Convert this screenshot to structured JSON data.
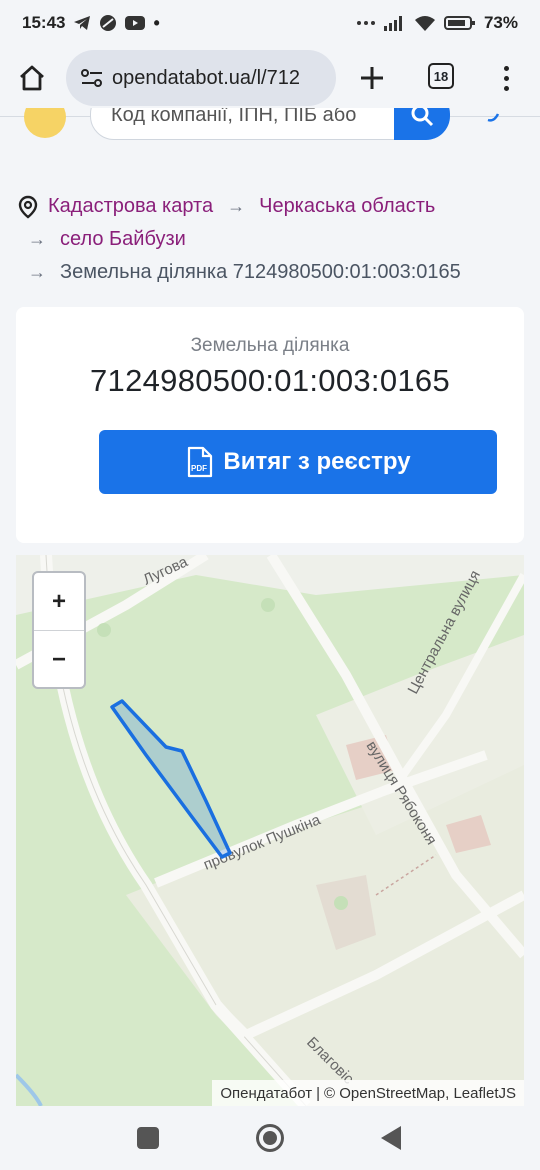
{
  "status_bar": {
    "time": "15:43",
    "battery": "73%"
  },
  "browser": {
    "url": "opendatabot.ua/l/712",
    "tab_count": "18"
  },
  "search": {
    "placeholder": "Код компанії, ІПН, ПІБ або"
  },
  "breadcrumb": {
    "items": [
      "Кадастрова карта",
      "Черкаська область",
      "село Байбузи"
    ],
    "current": "Земельна ділянка 7124980500:01:003:0165",
    "arrow": "→"
  },
  "card": {
    "label": "Земельна ділянка",
    "value": "7124980500:01:003:0165",
    "button_label": "Витяг з реєстру",
    "button_icon_text": "PDF"
  },
  "map": {
    "zoom_in": "+",
    "zoom_out": "−",
    "street_labels": [
      "Лугова",
      "Центральна вулиця",
      "вулиця Рябоконя",
      "провулок Пушкіна",
      "Благовіс"
    ],
    "attribution_owner": "Опендатабот",
    "attribution_sep": "|",
    "attribution_rest": "© OpenStreetMap, LeafletJS",
    "parcel_color": "#1a6fe0"
  },
  "colors": {
    "accent": "#1a73e8",
    "link": "#8a1f7a"
  }
}
